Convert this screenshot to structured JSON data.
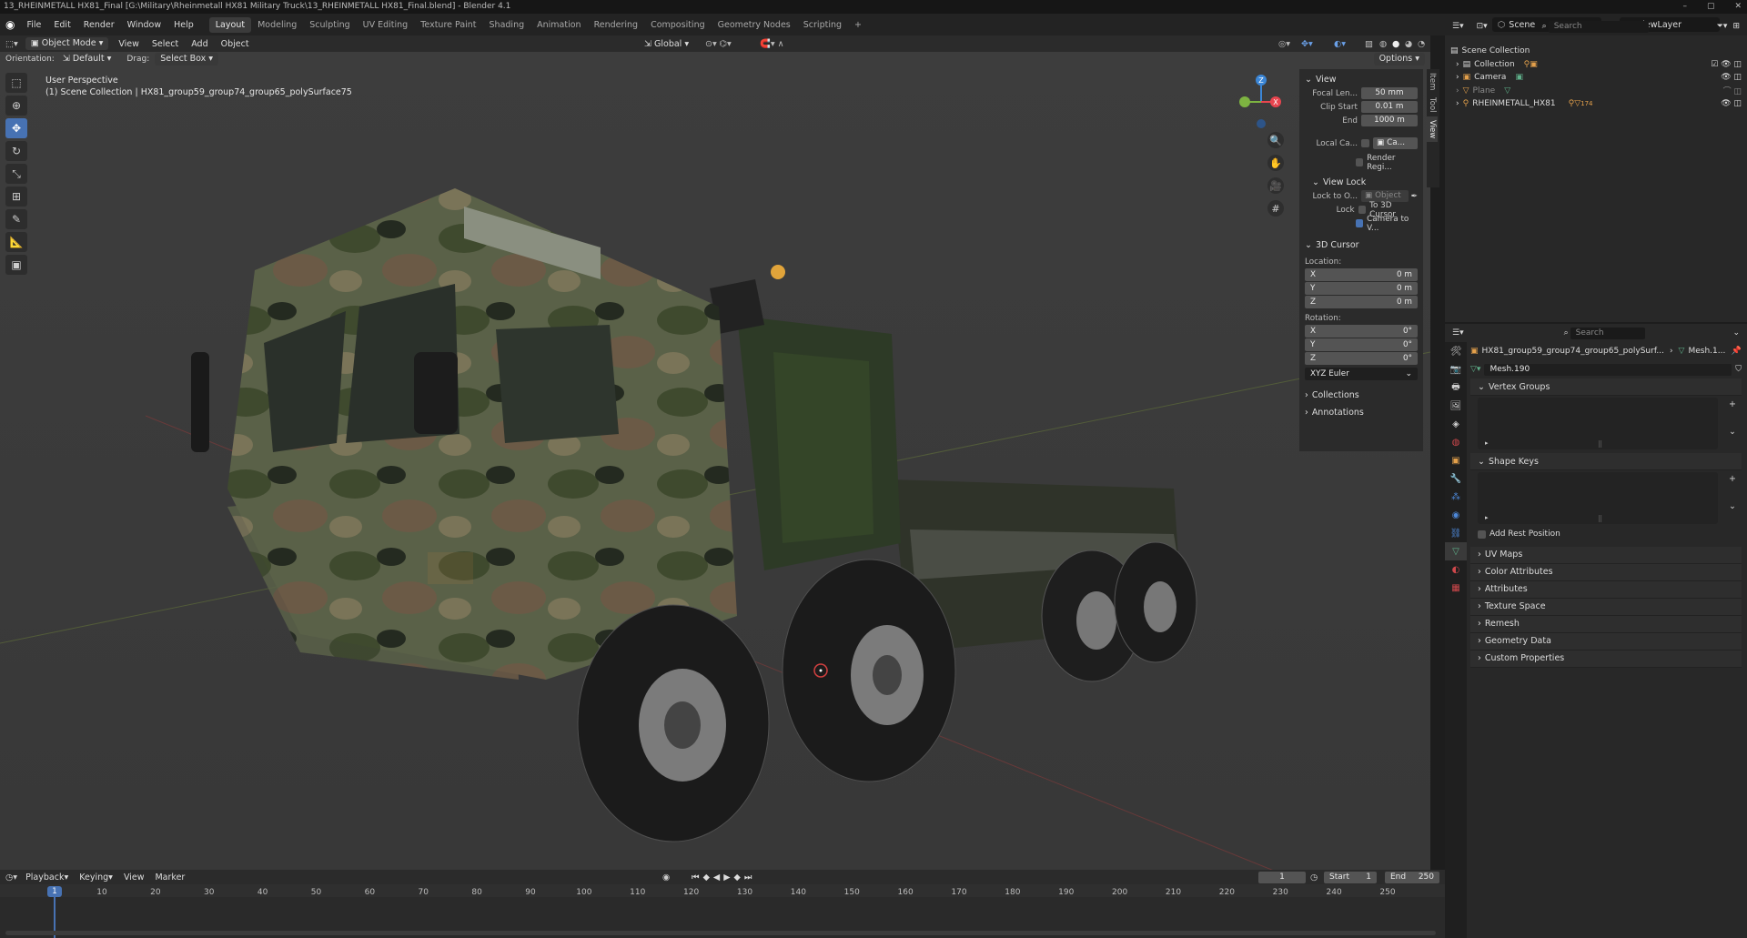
{
  "window": {
    "title": "13_RHEINMETALL HX81_Final [G:\\Military\\Rheinmetall HX81 Military Truck\\13_RHEINMETALL HX81_Final.blend] - Blender 4.1"
  },
  "menu": [
    "File",
    "Edit",
    "Render",
    "Window",
    "Help"
  ],
  "workspaces": [
    "Layout",
    "Modeling",
    "Sculpting",
    "UV Editing",
    "Texture Paint",
    "Shading",
    "Animation",
    "Rendering",
    "Compositing",
    "Geometry Nodes",
    "Scripting"
  ],
  "active_workspace": "Layout",
  "scene": {
    "label": "Scene"
  },
  "viewlayer": {
    "label": "ViewLayer"
  },
  "viewport_header": {
    "mode": "Object Mode",
    "menus": [
      "View",
      "Select",
      "Add",
      "Object"
    ],
    "transform_orientation": "Global",
    "options": "Options"
  },
  "viewport_sub": {
    "orientation_label": "Orientation:",
    "orientation_value": "Default",
    "drag_label": "Drag:",
    "drag_value": "Select Box"
  },
  "viewport_info": {
    "perspective": "User Perspective",
    "collection": "(1) Scene Collection | HX81_group59_group74_group65_polySurface75"
  },
  "gizmo": {
    "z": "Z",
    "x": "X",
    "y": "Y"
  },
  "sidebar": {
    "tabs": [
      "Item",
      "Tool",
      "View"
    ],
    "view_section": "View",
    "focal_label": "Focal Len...",
    "focal_value": "50 mm",
    "clip_start_label": "Clip Start",
    "clip_start_value": "0.01 m",
    "end_label": "End",
    "end_value": "1000 m",
    "local_camera_label": "Local Ca...",
    "local_camera_value": "Ca...",
    "render_region": "Render Regi...",
    "view_lock_section": "View Lock",
    "lock_to_label": "Lock to O...",
    "lock_to_value": "Object",
    "lock_label": "Lock",
    "to_cursor": "To 3D Cursor",
    "camera_to_view": "Camera to V...",
    "cursor_section": "3D Cursor",
    "location_label": "Location:",
    "loc": [
      {
        "axis": "X",
        "value": "0 m"
      },
      {
        "axis": "Y",
        "value": "0 m"
      },
      {
        "axis": "Z",
        "value": "0 m"
      }
    ],
    "rotation_label": "Rotation:",
    "rot": [
      {
        "axis": "X",
        "value": "0°"
      },
      {
        "axis": "Y",
        "value": "0°"
      },
      {
        "axis": "Z",
        "value": "0°"
      }
    ],
    "rotation_mode": "XYZ Euler",
    "collections": "Collections",
    "annotations": "Annotations"
  },
  "outliner": {
    "search_placeholder": "Search",
    "root": "Scene Collection",
    "items": [
      "Collection",
      "Camera",
      "Plane",
      "RHEINMETALL_HX81"
    ],
    "badge": "174"
  },
  "properties": {
    "search_placeholder": "Search",
    "breadcrumb_object": "HX81_group59_group74_group65_polySurf...",
    "breadcrumb_mesh": "Mesh.1...",
    "mesh_name": "Mesh.190",
    "vertex_groups": "Vertex Groups",
    "shape_keys": "Shape Keys",
    "add_rest_position": "Add Rest Position",
    "sections": [
      "UV Maps",
      "Color Attributes",
      "Attributes",
      "Texture Space",
      "Remesh",
      "Geometry Data",
      "Custom Properties"
    ]
  },
  "timeline": {
    "menus": [
      "Playback",
      "Keying",
      "View",
      "Marker"
    ],
    "current_frame": "1",
    "start_label": "Start",
    "start_value": "1",
    "end_label": "End",
    "end_value": "250",
    "frames": [
      "1",
      "10",
      "20",
      "30",
      "40",
      "50",
      "60",
      "70",
      "80",
      "90",
      "100",
      "110",
      "120",
      "130",
      "140",
      "150",
      "160",
      "170",
      "180",
      "190",
      "200",
      "210",
      "220",
      "230",
      "240",
      "250"
    ]
  },
  "colors": {
    "accent": "#4772b3",
    "axis_x": "#e8454f",
    "axis_y": "#7db341",
    "axis_z": "#3b86d6"
  }
}
